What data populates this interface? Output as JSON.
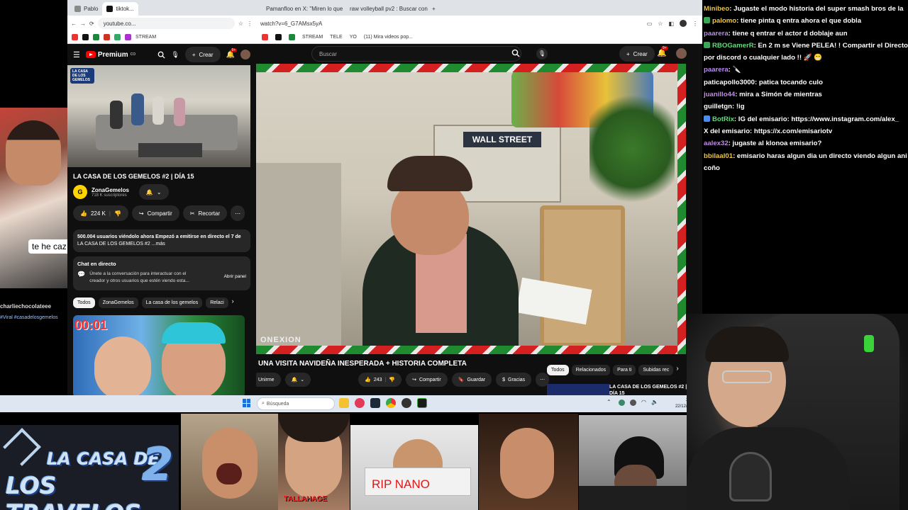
{
  "win1": {
    "tabs": [
      "Pablo",
      "tiktok..."
    ],
    "address": "youtube.co...",
    "bookmark_label": "STREAM",
    "yt": {
      "brand": "Premium",
      "brand_sup": "CO",
      "create_label": "Crear",
      "notif_count": "9+",
      "thumb_logo_text": "LA CASA DE LOS GEMELOS",
      "title": "LA CASA DE LOS GEMELOS #2 | DÍA 15",
      "channel": "ZonaGemelos",
      "subs": "718 K suscriptores",
      "likes": "224 K",
      "share": "Compartir",
      "clip": "Recortar",
      "desc_stats": "500.004 usuarios viéndolo ahora  Empezó a emitirse en directo el 7 de",
      "desc_line2": "LA CASA DE LOS GEMELOS #2 ...más",
      "chat_title": "Chat en directo",
      "chat_text1": "Únete a la conversación para interactuar con el",
      "chat_text2": "creador y otros usuarios que estén viendo esta...",
      "chat_button": "Abrir panel",
      "chips": [
        "Todos",
        "ZonaGemelos",
        "La casa de los gemelos",
        "Relaci"
      ],
      "rec_timer": "00:01"
    }
  },
  "win2": {
    "tabs": [
      "Pamanfloo en X: \"Miren lo que...",
      "raw volleyball pv2 : Buscar con...",
      "+"
    ],
    "address": "watch?v=6_G7AMsx5yA",
    "bookmarks": [
      "STREAM",
      "TELE",
      "YO",
      "(11) Mira videos pop..."
    ],
    "search_placeholder": "Buscar",
    "create_label": "Crear",
    "notif_count": "9+",
    "video_sign": "WALL STREET",
    "video_watermark": "ONEXION",
    "title": "UNA VISITA NAVIDEÑA INESPERADA + HISTORIA COMPLETA",
    "subscribe": "Unirme",
    "likes": "243",
    "share": "Compartir",
    "save": "Guardar",
    "thanks": "Gracias",
    "chips": [
      "Todos",
      "Relacionados",
      "Para ti",
      "Subidas rec"
    ],
    "rec_title": "LA CASA DE LOS GEMELOS #2 | DÍA 15",
    "colors": {
      "stripe_green": "#1f8a2f",
      "stripe_red": "#d42020"
    }
  },
  "taskbar": {
    "search_label": "Búsqueda",
    "time": "22:18",
    "date": "22/12/2025"
  },
  "chat": {
    "messages": [
      {
        "user": "Minibeo",
        "color": "#e8c44a",
        "badge": "",
        "text": ": Jugaste el modo historia del super smash bros de la"
      },
      {
        "user": "palomo",
        "color": "#f6c938",
        "badge": "#3aa657",
        "text": ": tiene pinta q entra ahora el que dobla"
      },
      {
        "user": "paarera",
        "color": "#b68cf0",
        "badge": "",
        "text": ": tiene q entrar el actor d doblaje aun"
      },
      {
        "user": "RBOGamerR",
        "color": "#5de07a",
        "badge": "#3aa657",
        "text": ": En 2 m se Viene PELEA! ! Compartir el Directo"
      },
      {
        "user": "",
        "color": "#ffffff",
        "badge": "",
        "text": "por discord o cualquier lado !! 🚀 😁"
      },
      {
        "user": "paarera",
        "color": "#b68cf0",
        "badge": "",
        "text": ": 🔪"
      },
      {
        "user": "paticapollo3000",
        "color": "#ffffff",
        "badge": "",
        "text": ": patica tocando culo"
      },
      {
        "user": "juanillo44",
        "color": "#c28ce8",
        "badge": "",
        "text": ": mira a Simón de mientras"
      },
      {
        "user": "guilletgn",
        "color": "#ffffff",
        "badge": "",
        "text": ": !ig"
      },
      {
        "user": "BotRix",
        "color": "#5de07a",
        "badge": "#4a8df0",
        "text": ": IG del emisario: https://www.instagram.com/alex_"
      },
      {
        "user": "",
        "color": "#ffffff",
        "badge": "",
        "text": "X del emisario: https://x.com/emisariotv"
      },
      {
        "user": "aalex32",
        "color": "#c28ce8",
        "badge": "",
        "text": ": jugaste al klonoa emisario?"
      },
      {
        "user": "bbilaal01",
        "color": "#e8c44a",
        "badge": "",
        "text": ": emisario haras algun dia un directo viendo algun ani"
      },
      {
        "user": "",
        "color": "#ffffff",
        "badge": "",
        "text": "coño"
      }
    ]
  },
  "overlays": {
    "cam_left_caption": "te he caz",
    "cam_user": "charliechocolateee",
    "cam_hashtags": "#Viral #casadelosgemelos",
    "logo_line1": "LA CASA DE",
    "logo_line2": "LOS TRAVELOS",
    "logo_num": "2",
    "tile_tallahage": "TALLAHAGE",
    "tile_rip": "RIP NANO"
  }
}
